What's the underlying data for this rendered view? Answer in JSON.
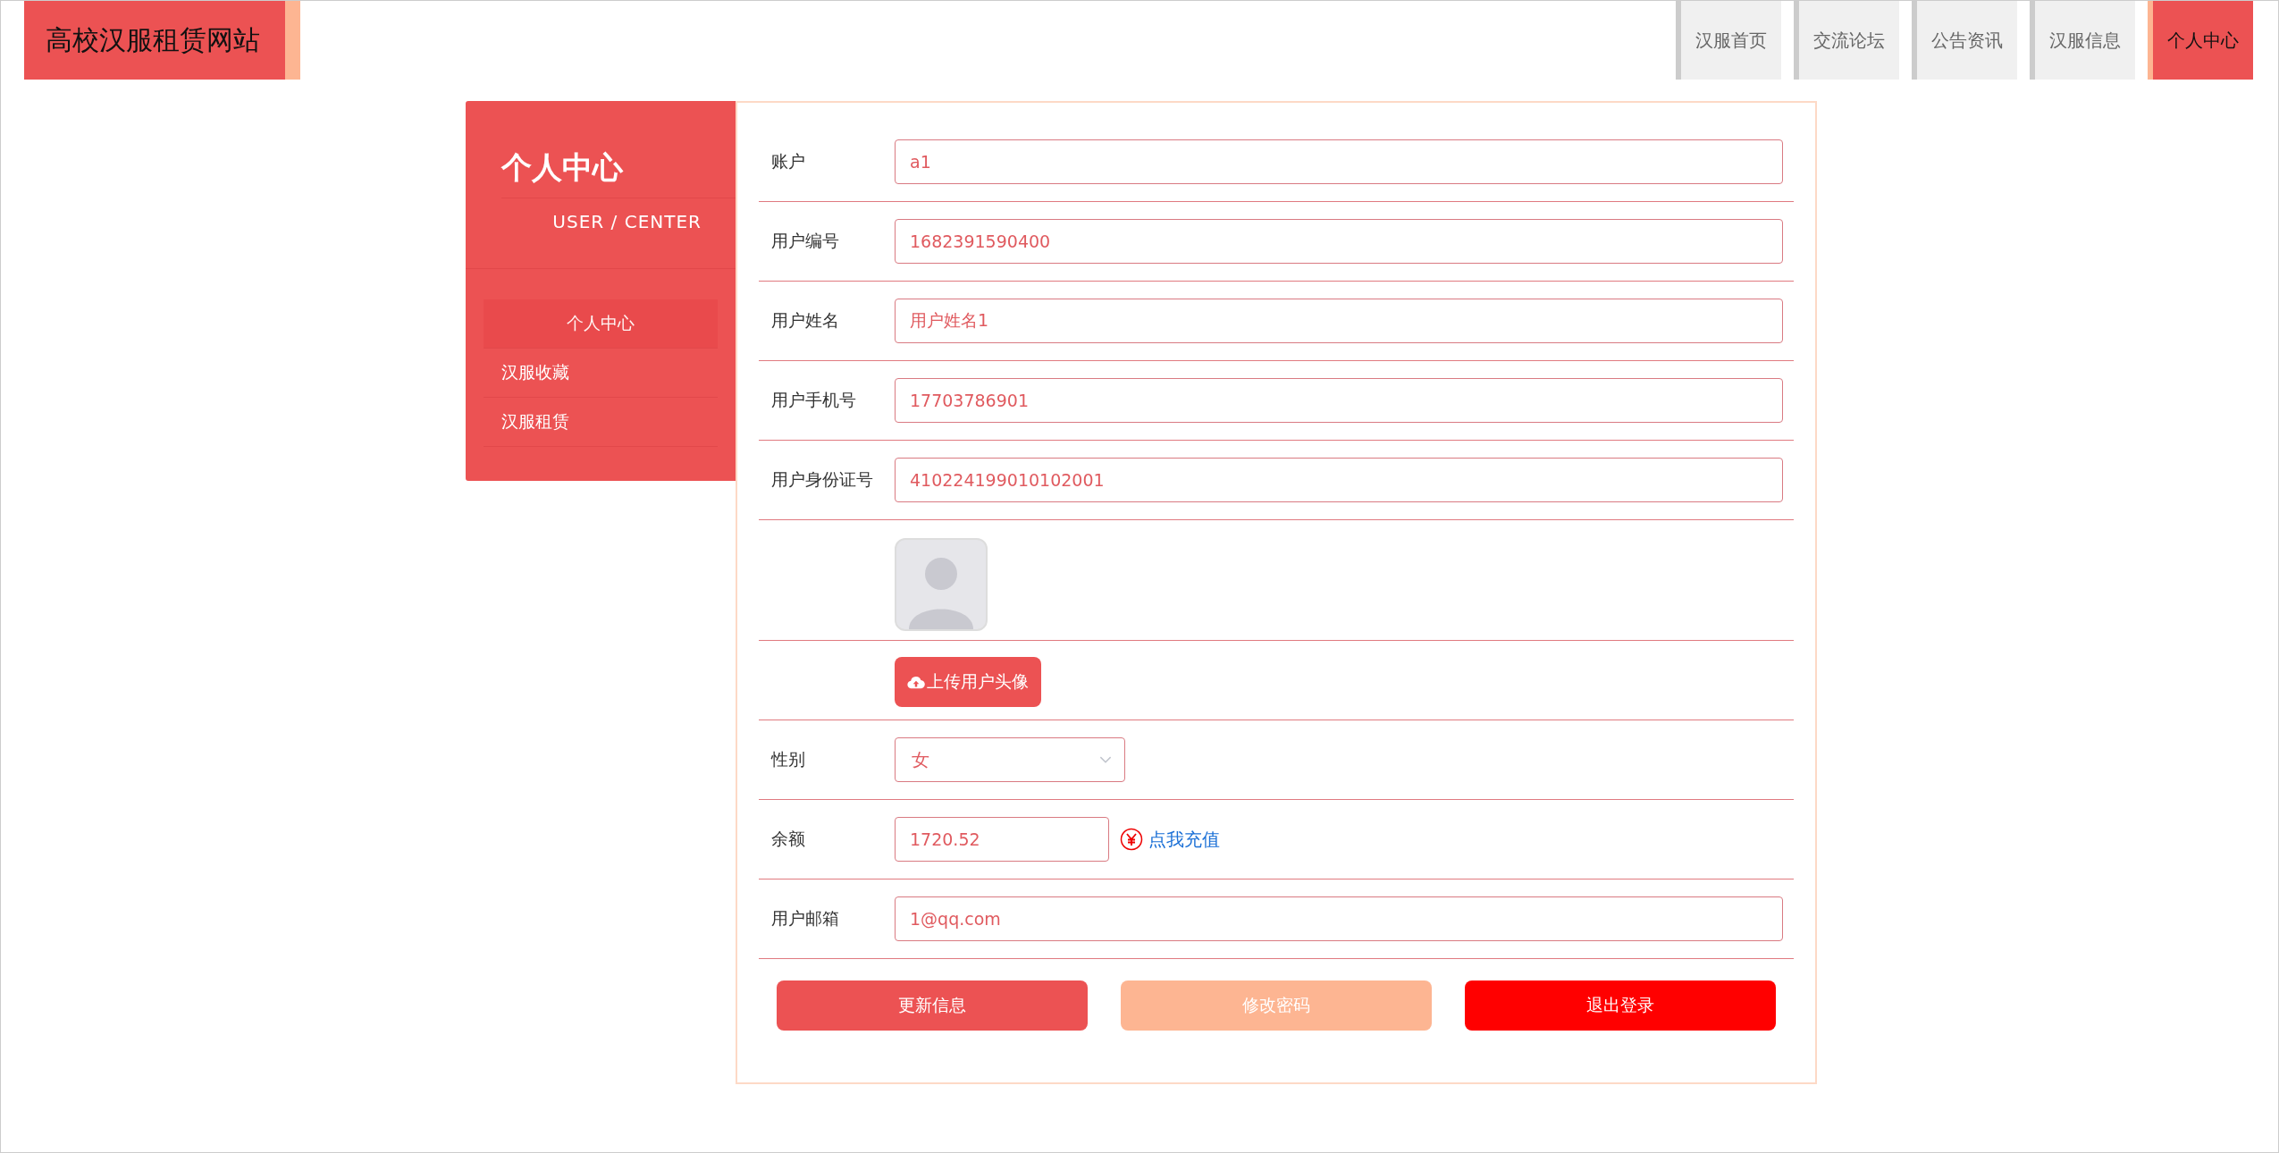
{
  "site_title": "高校汉服租赁网站",
  "nav": [
    {
      "label": "汉服首页",
      "selected": false
    },
    {
      "label": "交流论坛",
      "selected": false
    },
    {
      "label": "公告资讯",
      "selected": false
    },
    {
      "label": "汉服信息",
      "selected": false
    },
    {
      "label": "个人中心",
      "selected": true
    }
  ],
  "sidebar": {
    "title": "个人中心",
    "subtitle": "USER / CENTER",
    "items": [
      {
        "label": "个人中心",
        "selected": true
      },
      {
        "label": "汉服收藏",
        "selected": false
      },
      {
        "label": "汉服租赁",
        "selected": false
      }
    ]
  },
  "form": {
    "rows": [
      {
        "kind": "text",
        "label": "账户",
        "value": "a1"
      },
      {
        "kind": "text",
        "label": "用户编号",
        "value": "1682391590400"
      },
      {
        "kind": "text",
        "label": "用户姓名",
        "value": "用户姓名1"
      },
      {
        "kind": "text",
        "label": "用户手机号",
        "value": "17703786901"
      },
      {
        "kind": "text",
        "label": "用户身份证号",
        "value": "410224199010102001"
      },
      {
        "kind": "image"
      },
      {
        "kind": "upload",
        "button": "上传用户头像"
      },
      {
        "kind": "select",
        "label": "性别",
        "value": "女"
      },
      {
        "kind": "balance",
        "label": "余额",
        "value": "1720.52",
        "link": "点我充值"
      },
      {
        "kind": "text",
        "label": "用户邮箱",
        "value": "1@qq.com"
      }
    ],
    "buttons": [
      {
        "label": "更新信息",
        "color": "#ec5253"
      },
      {
        "label": "修改密码",
        "color": "#fdb592"
      },
      {
        "label": "退出登录",
        "color": "#ff0000"
      }
    ]
  }
}
